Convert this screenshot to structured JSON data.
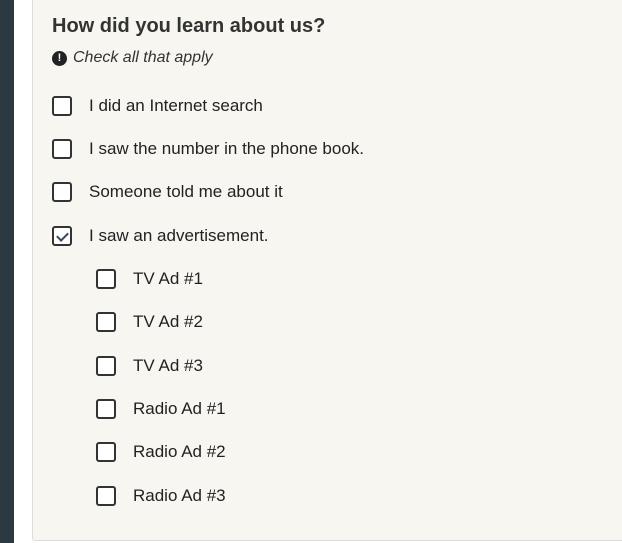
{
  "question": {
    "title": "How did you learn about us?",
    "hint_icon": "exclamation-circle-icon",
    "hint": "Check all that apply"
  },
  "options": [
    {
      "label": "I did an Internet search",
      "checked": false
    },
    {
      "label": "I saw the number in the phone book.",
      "checked": false
    },
    {
      "label": "Someone told me about it",
      "checked": false
    },
    {
      "label": "I saw an advertisement.",
      "checked": true
    }
  ],
  "sub_options": [
    {
      "label": "TV Ad #1",
      "checked": false
    },
    {
      "label": "TV Ad #2",
      "checked": false
    },
    {
      "label": "TV Ad #3",
      "checked": false
    },
    {
      "label": "Radio Ad #1",
      "checked": false
    },
    {
      "label": "Radio Ad #2",
      "checked": false
    },
    {
      "label": "Radio Ad #3",
      "checked": false
    }
  ]
}
